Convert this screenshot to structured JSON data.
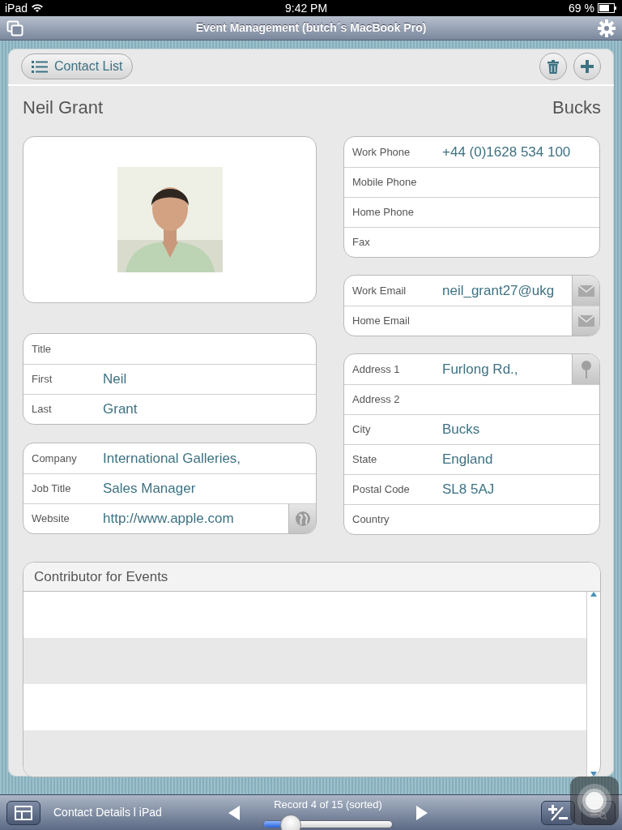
{
  "status_bar": {
    "device": "iPad",
    "time": "9:42 PM",
    "battery": "69 %"
  },
  "window": {
    "title": "Event Management (butch´s MacBook Pro)"
  },
  "toolbar": {
    "back_button": "Contact List"
  },
  "header": {
    "name": "Neil Grant",
    "city": "Bucks"
  },
  "left_groups": [
    [
      {
        "label": "Title"
      },
      {
        "label": "First",
        "value": "Neil"
      },
      {
        "label": "Last",
        "value": "Grant"
      }
    ],
    [
      {
        "label": "Company",
        "value": "International Galleries,"
      },
      {
        "label": "Job Title",
        "value": "Sales Manager"
      },
      {
        "label": "Website",
        "value": "http://www.apple.com",
        "kind": "web"
      }
    ]
  ],
  "right_groups": [
    [
      {
        "label": "Work Phone",
        "value": "+44 (0)1628 534 100"
      },
      {
        "label": "Mobile Phone"
      },
      {
        "label": "Home Phone"
      },
      {
        "label": "Fax"
      }
    ],
    [
      {
        "label": "Work Email",
        "value": "neil_grant27@ukg",
        "kind": "mail"
      },
      {
        "label": "Home Email",
        "kind": "mail"
      }
    ],
    [
      {
        "label": "Address 1",
        "value": "Furlong Rd.,",
        "kind": "map"
      },
      {
        "label": "Address 2"
      },
      {
        "label": "City",
        "value": "Bucks"
      },
      {
        "label": "State",
        "value": "England"
      },
      {
        "label": "Postal Code",
        "value": "SL8 5AJ"
      },
      {
        "label": "Country"
      }
    ]
  ],
  "portal": {
    "title": "Contributor for Events"
  },
  "bottom_bar": {
    "layout_name": "Contact Details l iPad",
    "record": "Record 4 of 15 (sorted)",
    "level": 0.21
  }
}
